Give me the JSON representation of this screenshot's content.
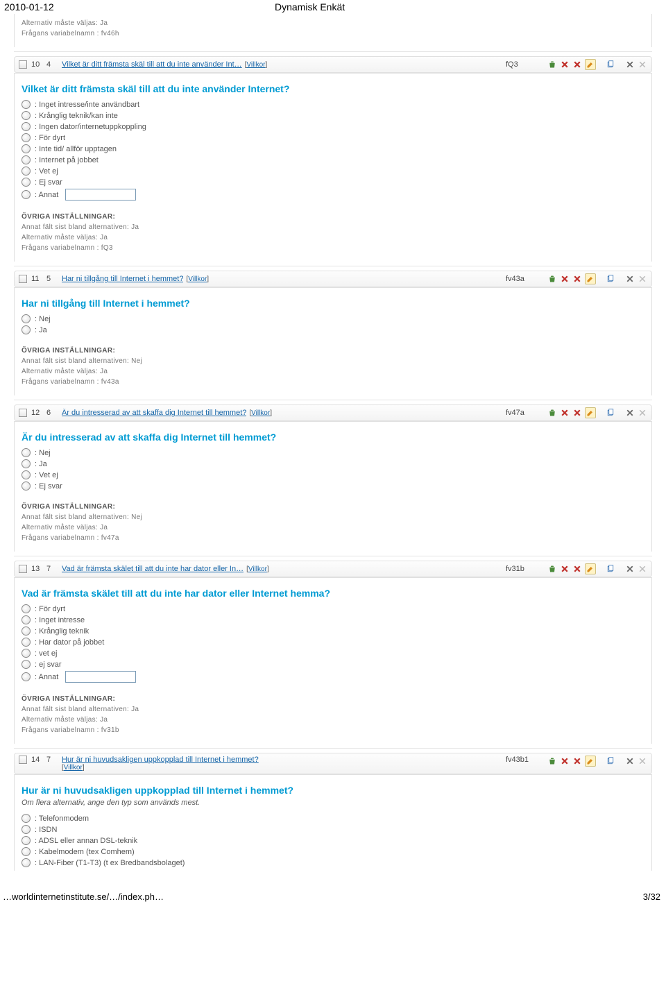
{
  "print": {
    "date": "2010-01-12",
    "title": "Dynamisk Enkät"
  },
  "labels": {
    "villkor": "Villkor",
    "settings_head": "ÖVRIGA INSTÄLLNINGAR:",
    "annat_last_prefix": "Annat fält sist bland alternativen: ",
    "alt_must_prefix": "Alternativ måste väljas: ",
    "varname_prefix": "Frågans variabelnamn : ",
    "ja": "Ja",
    "nej": "Nej"
  },
  "prev_card": {
    "alt_must": "Ja",
    "varname": "fv46h"
  },
  "q10": {
    "row": {
      "n1": "10",
      "n2": "4",
      "link": "Vilket är ditt främsta skäl till att du inte använder Int…",
      "code": "fQ3"
    },
    "title": "Vilket är ditt främsta skäl till att du inte använder Internet?",
    "options": [
      "Inget intresse/inte användbart",
      "Krånglig teknik/kan inte",
      "Ingen dator/internetuppkoppling",
      "För dyrt",
      "Inte tid/ allför upptagen",
      "Internet på jobbet",
      "Vet ej",
      "Ej svar",
      "Annat"
    ],
    "has_annat_input": true,
    "annat_last": "Ja",
    "alt_must": "Ja",
    "varname": "fQ3"
  },
  "q11": {
    "row": {
      "n1": "11",
      "n2": "5",
      "link": "Har ni tillgång till Internet i hemmet?",
      "code": "fv43a"
    },
    "title": "Har ni tillgång till Internet i hemmet?",
    "options": [
      "Nej",
      "Ja"
    ],
    "has_annat_input": false,
    "annat_last": "Nej",
    "alt_must": "Ja",
    "varname": "fv43a"
  },
  "q12": {
    "row": {
      "n1": "12",
      "n2": "6",
      "link": "Är du intresserad av att skaffa dig Internet till hemmet?",
      "code": "fv47a"
    },
    "title": "Är du intresserad av att skaffa dig Internet till hemmet?",
    "options": [
      "Nej",
      "Ja",
      "Vet ej",
      "Ej svar"
    ],
    "has_annat_input": false,
    "annat_last": "Nej",
    "alt_must": "Ja",
    "varname": "fv47a"
  },
  "q13": {
    "row": {
      "n1": "13",
      "n2": "7",
      "link": "Vad är främsta skälet till att du inte har dator eller In…",
      "code": "fv31b"
    },
    "title": "Vad är främsta skälet till att du inte har dator eller Internet hemma?",
    "options": [
      "För dyrt",
      "Inget intresse",
      "Krånglig teknik",
      "Har dator på jobbet",
      "vet ej",
      "ej svar",
      "Annat"
    ],
    "has_annat_input": true,
    "annat_last": "Ja",
    "alt_must": "Ja",
    "varname": "fv31b"
  },
  "q14": {
    "row": {
      "n1": "14",
      "n2": "7",
      "link": "Hur är ni huvudsakligen uppkopplad till Internet i hemmet?",
      "code": "fv43b1"
    },
    "title": "Hur är ni huvudsakligen uppkopplad till Internet i hemmet?",
    "subtitle": "Om flera alternativ, ange den typ som används mest.",
    "options": [
      "Telefonmodem",
      "ISDN",
      "ADSL eller annan DSL-teknik",
      "Kabelmodem (tex Comhem)",
      "LAN-Fiber (T1-T3) (t ex Bredbandsbolaget)"
    ]
  },
  "footer": {
    "left": "…worldinternetinstitute.se/…/index.ph…",
    "right": "3/32"
  }
}
